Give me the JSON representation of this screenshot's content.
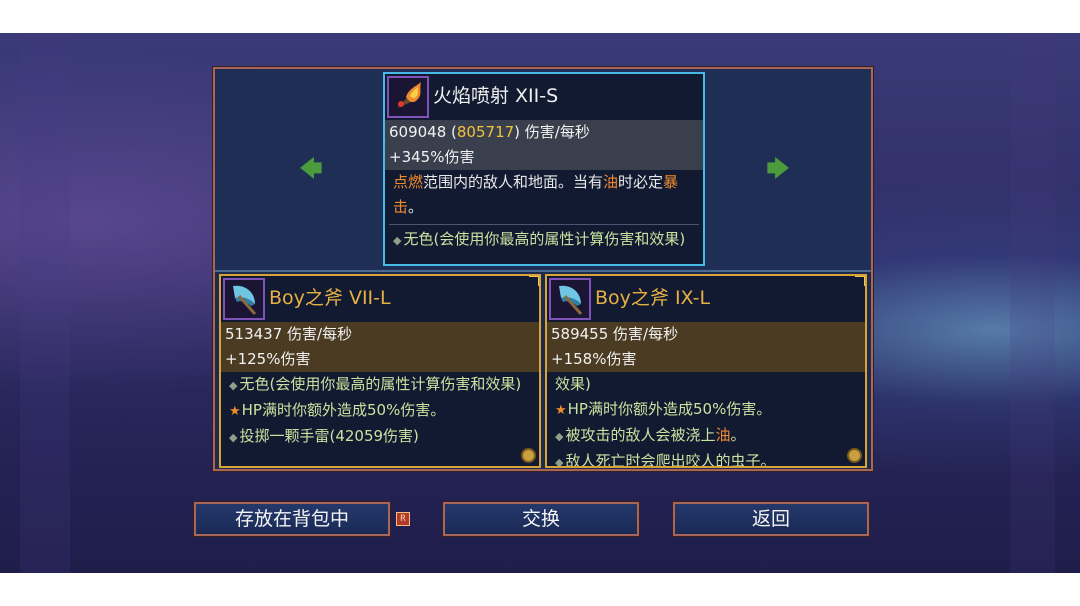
{
  "nav": {
    "prev_arrow": "🡄",
    "next_arrow": "🡆"
  },
  "current_item": {
    "title": "火焰喷射 XII-S",
    "dps_value": "609048",
    "dps_boost": "805717",
    "dps_unit": "伤害/每秒",
    "bonus": "+345%伤害",
    "desc_part1": "点燃",
    "desc_part2": "范围内的敌人和地面。当有",
    "desc_part3": "油",
    "desc_part4": "时必定",
    "desc_part5": "暴击",
    "desc_part6": "。",
    "affix1": "无色(会使用你最高的属性计算伤害和效果)",
    "icon": "flame-thrower-icon"
  },
  "compare_items": [
    {
      "title": "Boy之斧 VII-L",
      "dps": "513437 伤害/每秒",
      "bonus": "+125%伤害",
      "affix1": "无色(会使用你最高的属性计算伤害和效果)",
      "affix2": "HP满时你额外造成50%伤害。",
      "affix3": "投掷一颗手雷(42059伤害)",
      "icon": "axe-icon"
    },
    {
      "title": "Boy之斧 IX-L",
      "dps": "589455 伤害/每秒",
      "bonus": "+158%伤害",
      "affix0": "效果)",
      "affix1": "HP满时你额外造成50%伤害。",
      "affix2a": "被攻击的敌人会被浇上",
      "affix2b": "油",
      "affix2c": "。",
      "affix3": "敌人死亡时会爬出咬人的虫子。",
      "icon": "axe-icon"
    }
  ],
  "buttons": {
    "store": "存放在背包中",
    "swap": "交换",
    "back": "返回"
  },
  "key_hint": "R",
  "colors": {
    "panel_border": "#a8665a",
    "current_card_border": "#48b8e8",
    "compare_card_border": "#d8a43a",
    "item_title_gold": "#e7b043",
    "accent_orange": "#f08a2e",
    "arrow_green": "#4b9b3c"
  }
}
